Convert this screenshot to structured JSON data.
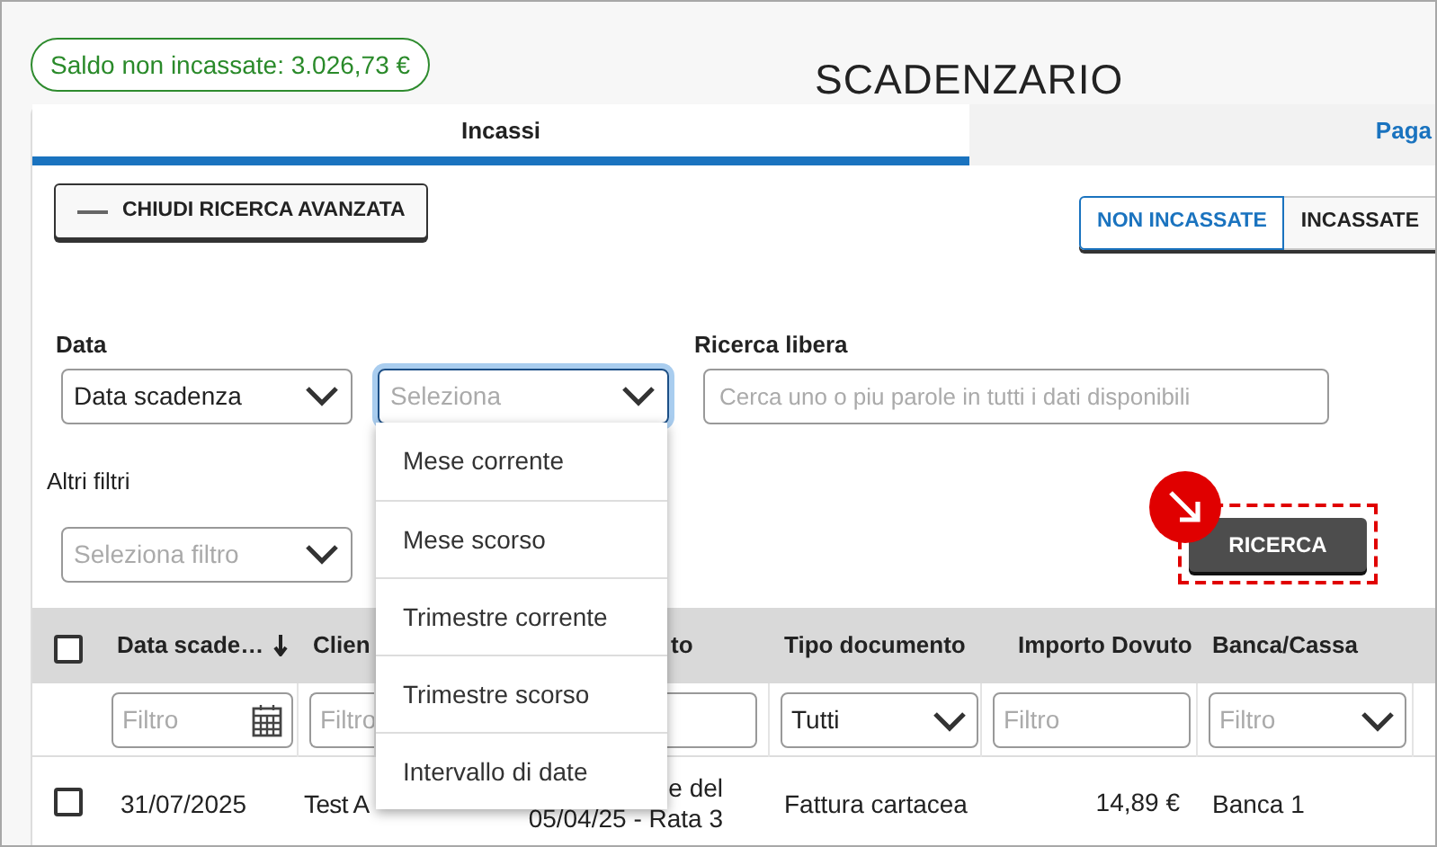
{
  "balance_badge": "Saldo non incassate: 3.026,73 €",
  "title": "SCADENZARIO",
  "tabs": [
    {
      "label": "Incassi",
      "selected": true
    },
    {
      "label": "Paga",
      "selected": false
    }
  ],
  "toggle_search_button": "CHIUDI RICERCA AVANZATA",
  "status_filter": [
    {
      "label": "NON INCASSATE",
      "selected": true
    },
    {
      "label": "INCASSATE",
      "selected": false
    }
  ],
  "date_filter": {
    "label": "Data",
    "type_select": {
      "value": "Data scadenza"
    },
    "period_select": {
      "placeholder": "Seleziona",
      "expanded": true,
      "options": [
        "Mese corrente",
        "Mese scorso",
        "Trimestre corrente",
        "Trimestre scorso",
        "Intervallo di date"
      ]
    }
  },
  "free_search": {
    "label": "Ricerca libera",
    "placeholder": "Cerca uno o piu parole in tutti i dati disponibili"
  },
  "other_filters": {
    "label": "Altri filtri",
    "select": {
      "placeholder": "Seleziona filtro"
    }
  },
  "search_button": {
    "label": "RICERCA",
    "highlighted": true
  },
  "table": {
    "header_checked": false,
    "columns": [
      {
        "label": "Data scade…",
        "sorted_descending": true
      },
      {
        "label": "Clien"
      },
      {
        "label": "to"
      },
      {
        "label": "Tipo documento"
      },
      {
        "label": "Importo Dovuto"
      },
      {
        "label": "Banca/Cassa"
      }
    ],
    "filters": [
      {
        "kind": "date",
        "placeholder": "Filtro"
      },
      {
        "kind": "text",
        "placeholder": "Filtro"
      },
      {
        "kind": "text"
      },
      {
        "kind": "select",
        "value": "Tutti"
      },
      {
        "kind": "text",
        "placeholder": "Filtro"
      },
      {
        "kind": "select",
        "placeholder": "Filtro"
      }
    ],
    "rows": [
      {
        "checked": false,
        "cells": [
          "31/07/2025",
          "Test A",
          [
            "e del",
            "05/04/25 - Rata 3"
          ],
          "Fattura cartacea",
          "14,89 €",
          "Banca 1"
        ]
      }
    ]
  }
}
